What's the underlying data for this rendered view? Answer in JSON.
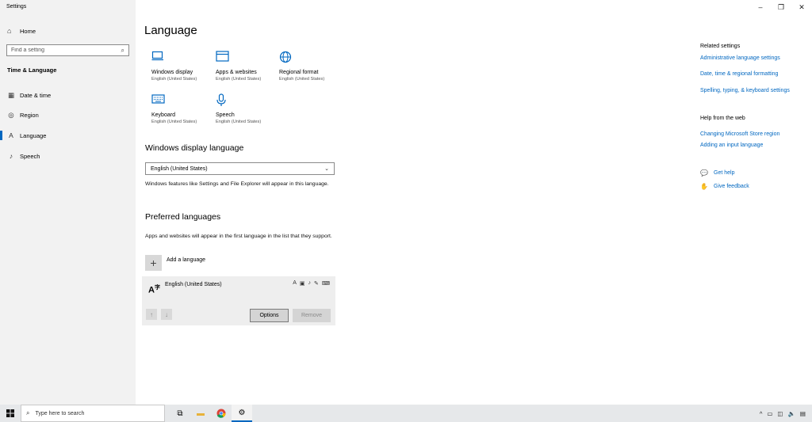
{
  "window": {
    "title": "Settings",
    "controls": [
      "–",
      "❐",
      "✕"
    ]
  },
  "sidebar": {
    "home_label": "Home",
    "search_placeholder": "Find a setting",
    "section_title": "Time & Language",
    "items": [
      {
        "label": "Date & time",
        "icon": "calendar-icon"
      },
      {
        "label": "Region",
        "icon": "globe-icon"
      },
      {
        "label": "Language",
        "icon": "language-icon",
        "active": true
      },
      {
        "label": "Speech",
        "icon": "microphone-icon"
      }
    ]
  },
  "main": {
    "title": "Language",
    "tiles": [
      {
        "title": "Windows display",
        "subtitle": "English (United States)",
        "icon": "monitor-icon"
      },
      {
        "title": "Apps & websites",
        "subtitle": "English (United States)",
        "icon": "app-window-icon"
      },
      {
        "title": "Regional format",
        "subtitle": "English (United States)",
        "icon": "globe-icon"
      },
      {
        "title": "Keyboard",
        "subtitle": "English (United States)",
        "icon": "keyboard-icon"
      },
      {
        "title": "Speech",
        "subtitle": "English (United States)",
        "icon": "microphone-icon"
      }
    ],
    "display_language": {
      "heading": "Windows display language",
      "selected": "English (United States)",
      "description": "Windows features like Settings and File Explorer will appear in this language."
    },
    "preferred": {
      "heading": "Preferred languages",
      "description": "Apps and websites will appear in the first language in the list that they support.",
      "add_label": "Add a language",
      "language_name": "English (United States)",
      "options_label": "Options",
      "remove_label": "Remove"
    }
  },
  "related": {
    "heading": "Related settings",
    "links": [
      "Administrative language settings",
      "Date, time & regional formatting",
      "Spelling, typing, & keyboard settings"
    ],
    "web_heading": "Help from the web",
    "web_links": [
      "Changing Microsoft Store region",
      "Adding an input language"
    ],
    "get_help": "Get help",
    "give_feedback": "Give feedback"
  },
  "taskbar": {
    "search_placeholder": "Type here to search"
  },
  "colors": {
    "accent": "#0067c0",
    "sidebar_bg": "#f2f2f2",
    "card_bg": "#eeeeee"
  }
}
